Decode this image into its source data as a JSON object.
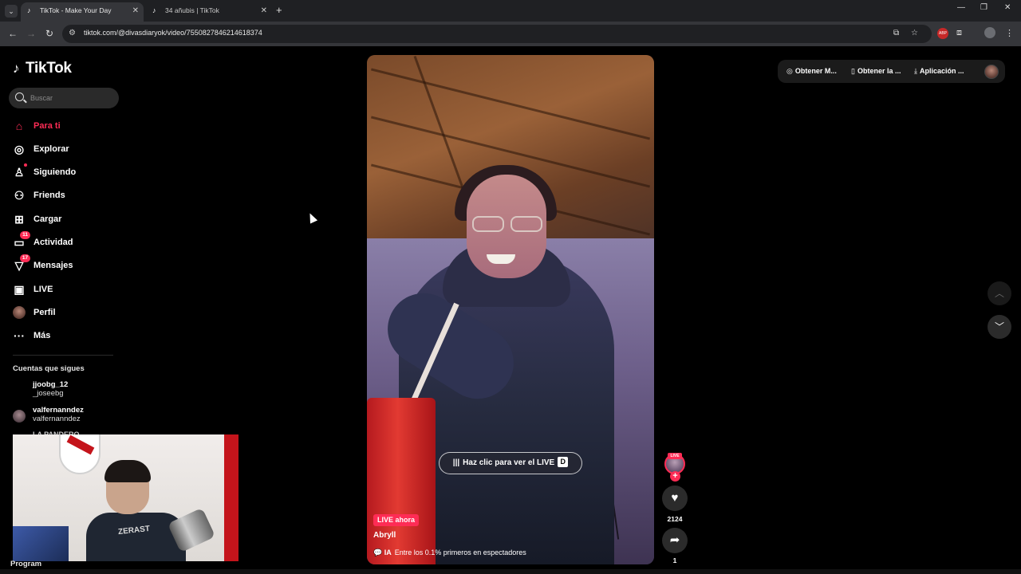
{
  "browser": {
    "tabs": [
      {
        "title": "TikTok - Make Your Day",
        "active": true
      },
      {
        "title": "34 añubis | TikTok",
        "active": false
      }
    ],
    "url": "tiktok.com/@divasdiaryok/video/7550827846214618374"
  },
  "sidebar": {
    "logo": "TikTok",
    "search_placeholder": "Buscar",
    "nav": [
      {
        "label": "Para ti",
        "icon": "home-icon",
        "active": true
      },
      {
        "label": "Explorar",
        "icon": "compass-icon"
      },
      {
        "label": "Siguiendo",
        "icon": "following-icon"
      },
      {
        "label": "Friends",
        "icon": "friends-icon"
      },
      {
        "label": "Cargar",
        "icon": "upload-icon"
      },
      {
        "label": "Actividad",
        "icon": "activity-icon",
        "badge": "11"
      },
      {
        "label": "Mensajes",
        "icon": "messages-icon",
        "badge": "17"
      },
      {
        "label": "LIVE",
        "icon": "live-tv-icon"
      },
      {
        "label": "Perfil",
        "icon": "profile-avatar"
      },
      {
        "label": "Más",
        "icon": "more-icon"
      }
    ],
    "following_title": "Cuentas que sigues",
    "accounts": [
      {
        "username": "jjoobg_12",
        "name": "_joseebg"
      },
      {
        "username": "valfernanndez",
        "name": "valfernanndez"
      }
    ],
    "partial_account": "LA PANDERO",
    "overlay_label": "Program"
  },
  "topbar": {
    "items": [
      {
        "label": "Obtener M...",
        "icon": "coin-icon"
      },
      {
        "label": "Obtener la ...",
        "icon": "phone-icon"
      },
      {
        "label": "Aplicación ...",
        "icon": "download-icon"
      }
    ]
  },
  "video": {
    "cta": "Haz clic para ver el LIVE",
    "cta_key": "D",
    "live_badge": "LIVE ahora",
    "author": "Abryll",
    "caption_tag": "IA",
    "caption": "Entre los 0.1% primeros en espectadores",
    "live_avatar_badge": "LIVE",
    "likes": "2124",
    "shares": "1"
  },
  "webcam": {
    "shirt_text": "ZERAST"
  }
}
